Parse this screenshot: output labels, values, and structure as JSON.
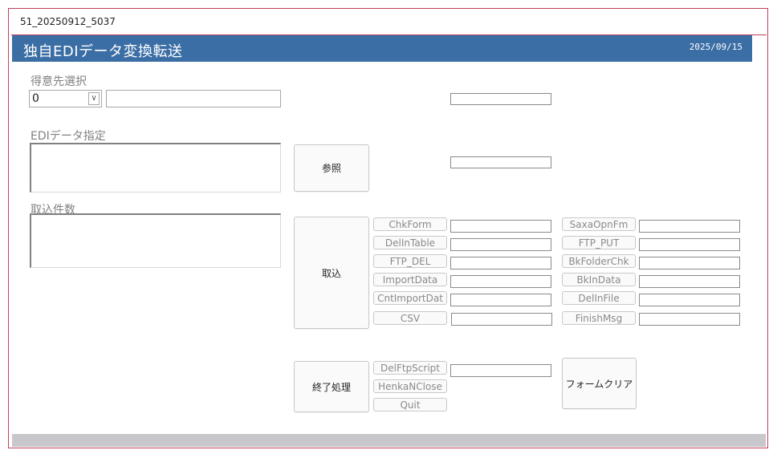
{
  "tab": {
    "title": "51_20250912_5037"
  },
  "header": {
    "title": "独自EDIデータ変換転送",
    "date": "2025/09/15",
    "bg_color": "#3a6ea5"
  },
  "customer": {
    "label": "得意先選択",
    "combo_value": "0"
  },
  "edi": {
    "label": "EDIデータ指定"
  },
  "count": {
    "label": "取込件数"
  },
  "buttons": {
    "browse": "参照",
    "import": "取込",
    "finish": "終了処理",
    "form_clear": "フォームクリア"
  },
  "steps_left": [
    "ChkForm",
    "DelInTable",
    "FTP_DEL",
    "ImportData",
    "CntImportDat",
    "CSV"
  ],
  "steps_right": [
    "SaxaOpnFm",
    "FTP_PUT",
    "BkFolderChk",
    "BkInData",
    "DelInFile",
    "FinishMsg"
  ],
  "steps_finish": [
    "DelFtpScript",
    "HenkaNClose",
    "Quit"
  ]
}
